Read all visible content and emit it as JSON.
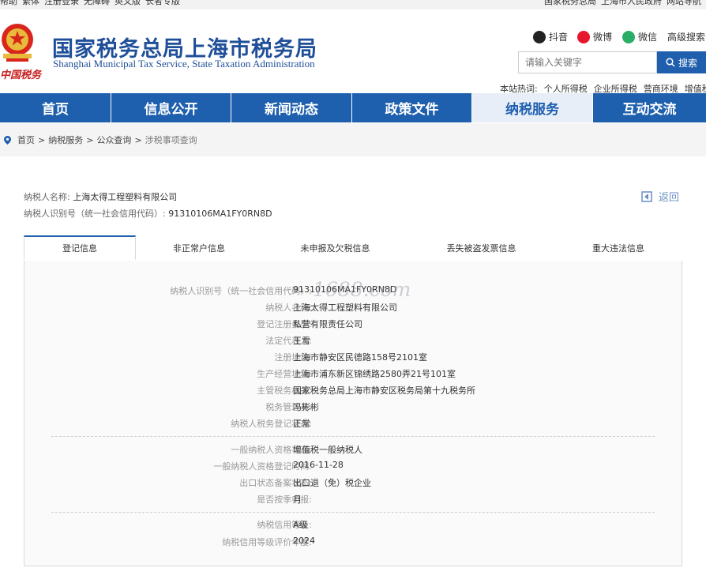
{
  "top_bar": {
    "left_links": [
      "帮助",
      "繁体",
      "注册登录",
      "无障碍",
      "英文版",
      "长者专版"
    ],
    "right_links": [
      "国家税务总局",
      "上海市人民政府",
      "网站导航"
    ]
  },
  "header": {
    "brand_cn": "国家税务总局上海市税务局",
    "brand_en": "Shanghai Municipal Tax Service, State Taxation Administration",
    "seal_text": "中国税务",
    "social": [
      {
        "label": "抖音",
        "icon": "douyin-icon",
        "color": "#222222"
      },
      {
        "label": "微博",
        "icon": "weibo-icon",
        "color": "#e6162d"
      },
      {
        "label": "微信",
        "icon": "wechat-icon",
        "color": "#2aae67"
      }
    ],
    "advanced_search": "高级搜索",
    "search_placeholder": "请输入关键字",
    "search_button": "搜索",
    "hot_label": "本站热词:",
    "hot_words": [
      "个人所得税",
      "企业所得税",
      "营商环境",
      "增值税"
    ]
  },
  "nav": {
    "items": [
      "首页",
      "信息公开",
      "新闻动态",
      "政策文件",
      "纳税服务",
      "互动交流"
    ],
    "active": "纳税服务"
  },
  "breadcrumb": {
    "items": [
      "首页",
      "纳税服务",
      "公众查询",
      "涉税事项查询"
    ],
    "separator": ">"
  },
  "taxpayer": {
    "name_label": "纳税人名称:",
    "name": "上海太得工程塑料有限公司",
    "id_label": "纳税人识别号（统一社会信用代码）:",
    "id": "91310106MA1FY0RN8D"
  },
  "back_label": "返回",
  "tabs": [
    "登记信息",
    "非正常户信息",
    "未申报及欠税信息",
    "丢失被盗发票信息",
    "重大违法信息"
  ],
  "active_tab": "登记信息",
  "watermark": "1688.com",
  "registration": {
    "group1": [
      {
        "label": "纳税人识别号（统一社会信用代码）:",
        "value": "91310106MA1FY0RN8D"
      },
      {
        "label": "纳税人名称:",
        "value": "上海太得工程塑料有限公司"
      },
      {
        "label": "登记注册类型:",
        "value": "私营有限责任公司"
      },
      {
        "label": "法定代表人:",
        "value": "王雪"
      },
      {
        "label": "注册地址:",
        "value": "上海市静安区民德路158号2101室"
      },
      {
        "label": "生产经营地址:",
        "value": "上海市浦东新区锦绣路2580弄21号101室"
      },
      {
        "label": "主管税务机关:",
        "value": "国家税务总局上海市静安区税务局第十九税务所"
      },
      {
        "label": "税务管理员:",
        "value": "冯彬彬"
      },
      {
        "label": "纳税人税务登记状态:",
        "value": "正常"
      }
    ],
    "group2": [
      {
        "label": "一般纳税人资格状态:",
        "value": "增值税一般纳税人"
      },
      {
        "label": "一般纳税人资格登记时间:",
        "value": "2016-11-28"
      },
      {
        "label": "出口状态备案状态:",
        "value": "出口退（免）税企业"
      },
      {
        "label": "是否按季申报:",
        "value": "月"
      }
    ],
    "group3": [
      {
        "label": "纳税信用等级:",
        "value": "A级"
      },
      {
        "label": "纳税信用等级评价年度:",
        "value": "2024"
      }
    ]
  }
}
